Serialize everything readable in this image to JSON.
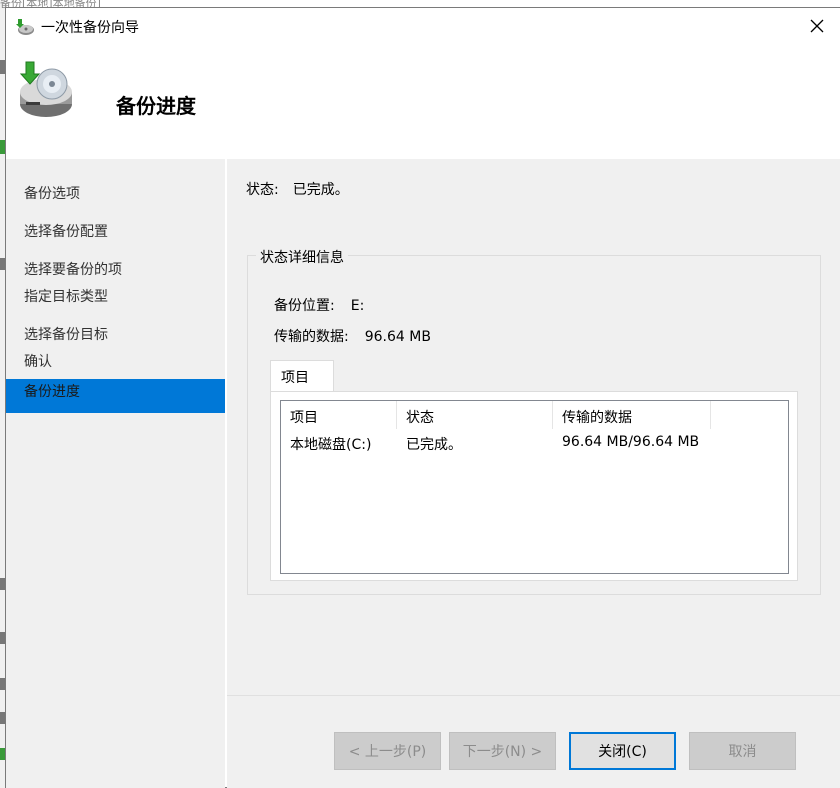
{
  "background_window": {
    "top_text": "备份[本地]本地备份]"
  },
  "dialog": {
    "title": "一次性备份向导",
    "header_title": "备份进度"
  },
  "nav": {
    "items": [
      {
        "label": "备份选项",
        "active": false
      },
      {
        "label": "选择备份配置",
        "active": false
      },
      {
        "label": "选择要备份的项",
        "active": false
      },
      {
        "label": "指定目标类型",
        "active": false
      },
      {
        "label": "选择备份目标",
        "active": false
      },
      {
        "label": "确认",
        "active": false
      },
      {
        "label": "备份进度",
        "active": true
      }
    ]
  },
  "status": {
    "label": "状态:",
    "value": "已完成。"
  },
  "details": {
    "group_label": "状态详细信息",
    "location_label": "备份位置:",
    "location_value": "E:",
    "transferred_label": "传输的数据:",
    "transferred_value": "96.64 MB",
    "tab_label": "项目",
    "columns": [
      "项目",
      "状态",
      "传输的数据"
    ],
    "rows": [
      {
        "item": "本地磁盘(C:)",
        "status": "已完成。",
        "data": "96.64 MB/96.64 MB"
      }
    ]
  },
  "buttons": {
    "prev": "< 上一步(P)",
    "next": "下一步(N) >",
    "close": "关闭(C)",
    "cancel": "取消"
  },
  "colors": {
    "accent": "#0078d7",
    "panel": "#f0f0f0"
  }
}
